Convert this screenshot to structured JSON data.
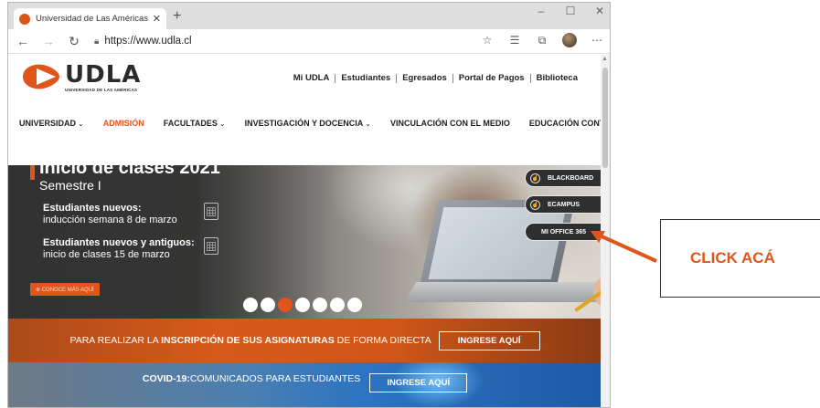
{
  "browser": {
    "tab_title": "Universidad de Las Américas acr",
    "tab_close": "✕",
    "new_tab": "+",
    "url": "https://www.udla.cl",
    "controls": {
      "minimize": "–",
      "maximize": "☐",
      "close": "✕"
    }
  },
  "header": {
    "logo_text": "UDLA",
    "logo_sub": "UNIVERSIDAD DE LAS AMÉRICAS",
    "top_links": [
      "Mi UDLA",
      "Estudiantes",
      "Egresados",
      "Portal de Pagos",
      "Biblioteca"
    ]
  },
  "nav": {
    "items": [
      {
        "label": "UNIVERSIDAD",
        "dropdown": true,
        "active": false
      },
      {
        "label": "ADMISIÓN",
        "dropdown": false,
        "active": true
      },
      {
        "label": "FACULTADES",
        "dropdown": true,
        "active": false
      },
      {
        "label": "INVESTIGACIÓN Y DOCENCIA",
        "dropdown": true,
        "active": false
      },
      {
        "label": "VINCULACIÓN CON EL MEDIO",
        "dropdown": false,
        "active": false
      },
      {
        "label": "EDUCACIÓN CONTINUA",
        "dropdown": false,
        "active": false
      }
    ],
    "chevron": "⌄"
  },
  "hero": {
    "title": "Inicio de clases 2021",
    "subtitle": "Semestre I",
    "info1_bold": "Estudiantes nuevos:",
    "info1_text": "inducción semana 8 de marzo",
    "info2_bold": "Estudiantes nuevos y antiguos:",
    "info2_text": "inicio de clases 15 de marzo",
    "cta": "⊕ CONOCE MÁS AQUÍ",
    "dots_total": 7,
    "dots_active": 3,
    "side_buttons": {
      "blackboard": "BLACKBOARD",
      "ecampus": "ECAMPUS",
      "office": "MI OFFICE 365"
    }
  },
  "banner_orange": {
    "text_pre": "PARA REALIZAR LA ",
    "text_bold": "INSCRIPCIÓN DE SUS ASIGNATURAS",
    "text_post": " DE FORMA DIRECTA",
    "button": "INGRESE AQUÍ"
  },
  "banner_blue": {
    "text_bold": "COVID-19:",
    "text": "COMUNICADOS PARA ESTUDIANTES",
    "button": "INGRESE AQUÍ"
  },
  "callout": {
    "text": "CLICK ACÁ"
  },
  "colors": {
    "accent": "#e0551b",
    "dark": "#2f2f2f"
  }
}
